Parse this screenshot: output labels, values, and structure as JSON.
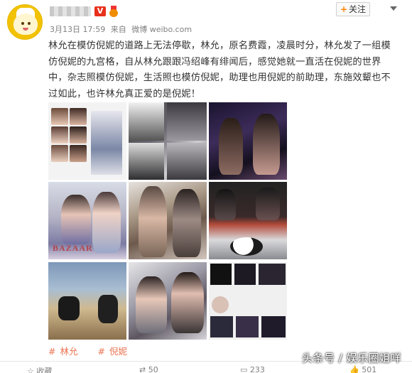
{
  "header": {
    "vip_badge": "V",
    "timestamp": "3月13日 17:59",
    "source_prefix": "来自",
    "source": "微博 weibo.com",
    "follow_label": "关注",
    "follow_plus": "+"
  },
  "post": {
    "text": "林允在模仿倪妮的道路上无法停歇，林允，原名费霞，凌晨时分，林允发了一组模仿倪妮的九宫格，自从林允跟跟冯绍峰有绯闻后，感觉她就一直活在倪妮的世界中，杂志照模仿倪妮，生活照也模仿倪妮，助理也用倪妮的前助理，东施效颦也不过如此，也许林允真正爱的是倪妮！"
  },
  "images": {
    "magazine_text": "BAZAAR"
  },
  "topics": [
    {
      "hash": "#",
      "label": "林允"
    },
    {
      "hash": "#",
      "label": "倪妮"
    }
  ],
  "footer": {
    "favorite": "收藏",
    "repost_count": "50",
    "comment_count": "233",
    "like_count": "501"
  },
  "watermark": "头条号 / 娱乐圈姐咩",
  "colors": {
    "accent": "#eb7350",
    "follow_plus": "#ff8200",
    "vip": "#e8301b"
  }
}
